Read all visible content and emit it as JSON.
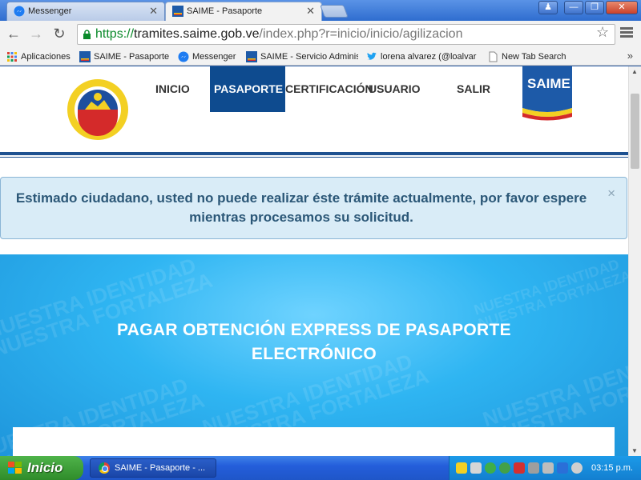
{
  "browser": {
    "tabs": [
      {
        "title": "Messenger",
        "active": false
      },
      {
        "title": "SAIME - Pasaporte",
        "active": true
      }
    ],
    "url": {
      "scheme": "https://",
      "host": "tramites.saime.gob.ve",
      "path": "/index.php?r=inicio/inicio/agilizacion"
    },
    "bookmarks": [
      {
        "label": "Aplicaciones",
        "icon": "apps-grid-icon"
      },
      {
        "label": "SAIME - Pasaporte",
        "icon": "saime-favicon"
      },
      {
        "label": "Messenger",
        "icon": "messenger-icon"
      },
      {
        "label": "SAIME - Servicio Adminis",
        "icon": "saime-favicon"
      },
      {
        "label": "lorena alvarez (@loalvar",
        "icon": "twitter-icon"
      },
      {
        "label": "New Tab Search",
        "icon": "page-icon"
      }
    ],
    "bookmarks_more": "»"
  },
  "site": {
    "nav": {
      "inicio": "INICIO",
      "pasaporte": "PASAPORTE",
      "certificacion": "CERTIFICACIÓN",
      "usuario": "USUARIO",
      "salir": "SALIR"
    },
    "logo_text": "SAIME",
    "alert": {
      "message": "Estimado ciudadano, usted no puede realizar éste trámite actualmente, por favor espere mientras procesamos su solicitud.",
      "close": "×"
    },
    "hero": {
      "title": "PAGAR OBTENCIÓN EXPRESS DE PASAPORTE ELECTRÓNICO",
      "watermark_lines": [
        "NUESTRA IDENTIDAD",
        "NUESTRA FORTALEZA"
      ]
    }
  },
  "taskbar": {
    "start_label": "Inicio",
    "task_item": "SAIME - Pasaporte - ...",
    "clock": "03:15 p.m."
  },
  "colors": {
    "nav_active": "#0e4b8f",
    "alert_bg": "#d9ecf7",
    "hero_blue": "#2fb5f2"
  }
}
